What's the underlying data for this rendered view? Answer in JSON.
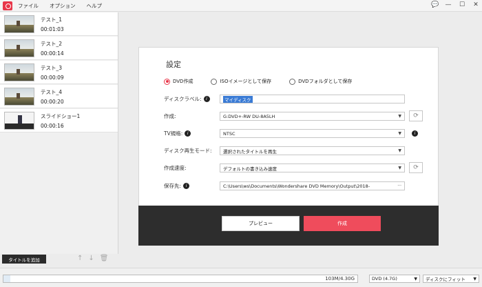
{
  "menu": {
    "items": [
      "ファイル",
      "オプション",
      "ヘルプ"
    ],
    "window_controls": [
      "💬",
      "—",
      "☐",
      "✕"
    ]
  },
  "clips": [
    {
      "name": "テスト_1",
      "duration": "00:01:03"
    },
    {
      "name": "テスト_2",
      "duration": "00:00:14"
    },
    {
      "name": "テスト_3",
      "duration": "00:00:09"
    },
    {
      "name": "テスト_4",
      "duration": "00:00:20"
    },
    {
      "name": "スライドショー1",
      "duration": "00:00:16"
    }
  ],
  "sidebar": {
    "add_title_label": "タイトルを追加",
    "tool_icons": [
      "arrow-up-icon",
      "arrow-down-icon",
      "trash-icon"
    ]
  },
  "settings": {
    "title": "設定",
    "radio_options": [
      {
        "label": "DVD作成",
        "selected": true
      },
      {
        "label": "ISOイメージとして保存",
        "selected": false
      },
      {
        "label": "DVDフォルダとして保存",
        "selected": false
      }
    ],
    "disc_label": {
      "label": "ディスクラベル:",
      "value": "マイディスク"
    },
    "burner": {
      "label": "作成:",
      "value": "G:DVD+-RW DU-8A5LH"
    },
    "tv_standard": {
      "label": "TV規格:",
      "value": "NTSC"
    },
    "playback_mode": {
      "label": "ディスク再生モード:",
      "value": "選択されたタイトルを再生"
    },
    "burn_speed": {
      "label": "作成速度:",
      "value": "デフォルトの書き込み速度"
    },
    "save_to": {
      "label": "保存先:",
      "value": "C:\\Users\\ws\\Documents\\Wondershare DVD Memory\\Output\\2018-",
      "more": "···"
    },
    "preview_button": "プレビュー",
    "create_button": "作成"
  },
  "status_bar": {
    "size_text": "103M/4.30G",
    "progress": 0.02,
    "disc_type": "DVD (4.7G)",
    "fit_mode": "ディスクにフィット"
  },
  "colors": {
    "accent": "#ef4c5c",
    "selection": "#3a7bd5",
    "footer": "#2d2d2d"
  }
}
